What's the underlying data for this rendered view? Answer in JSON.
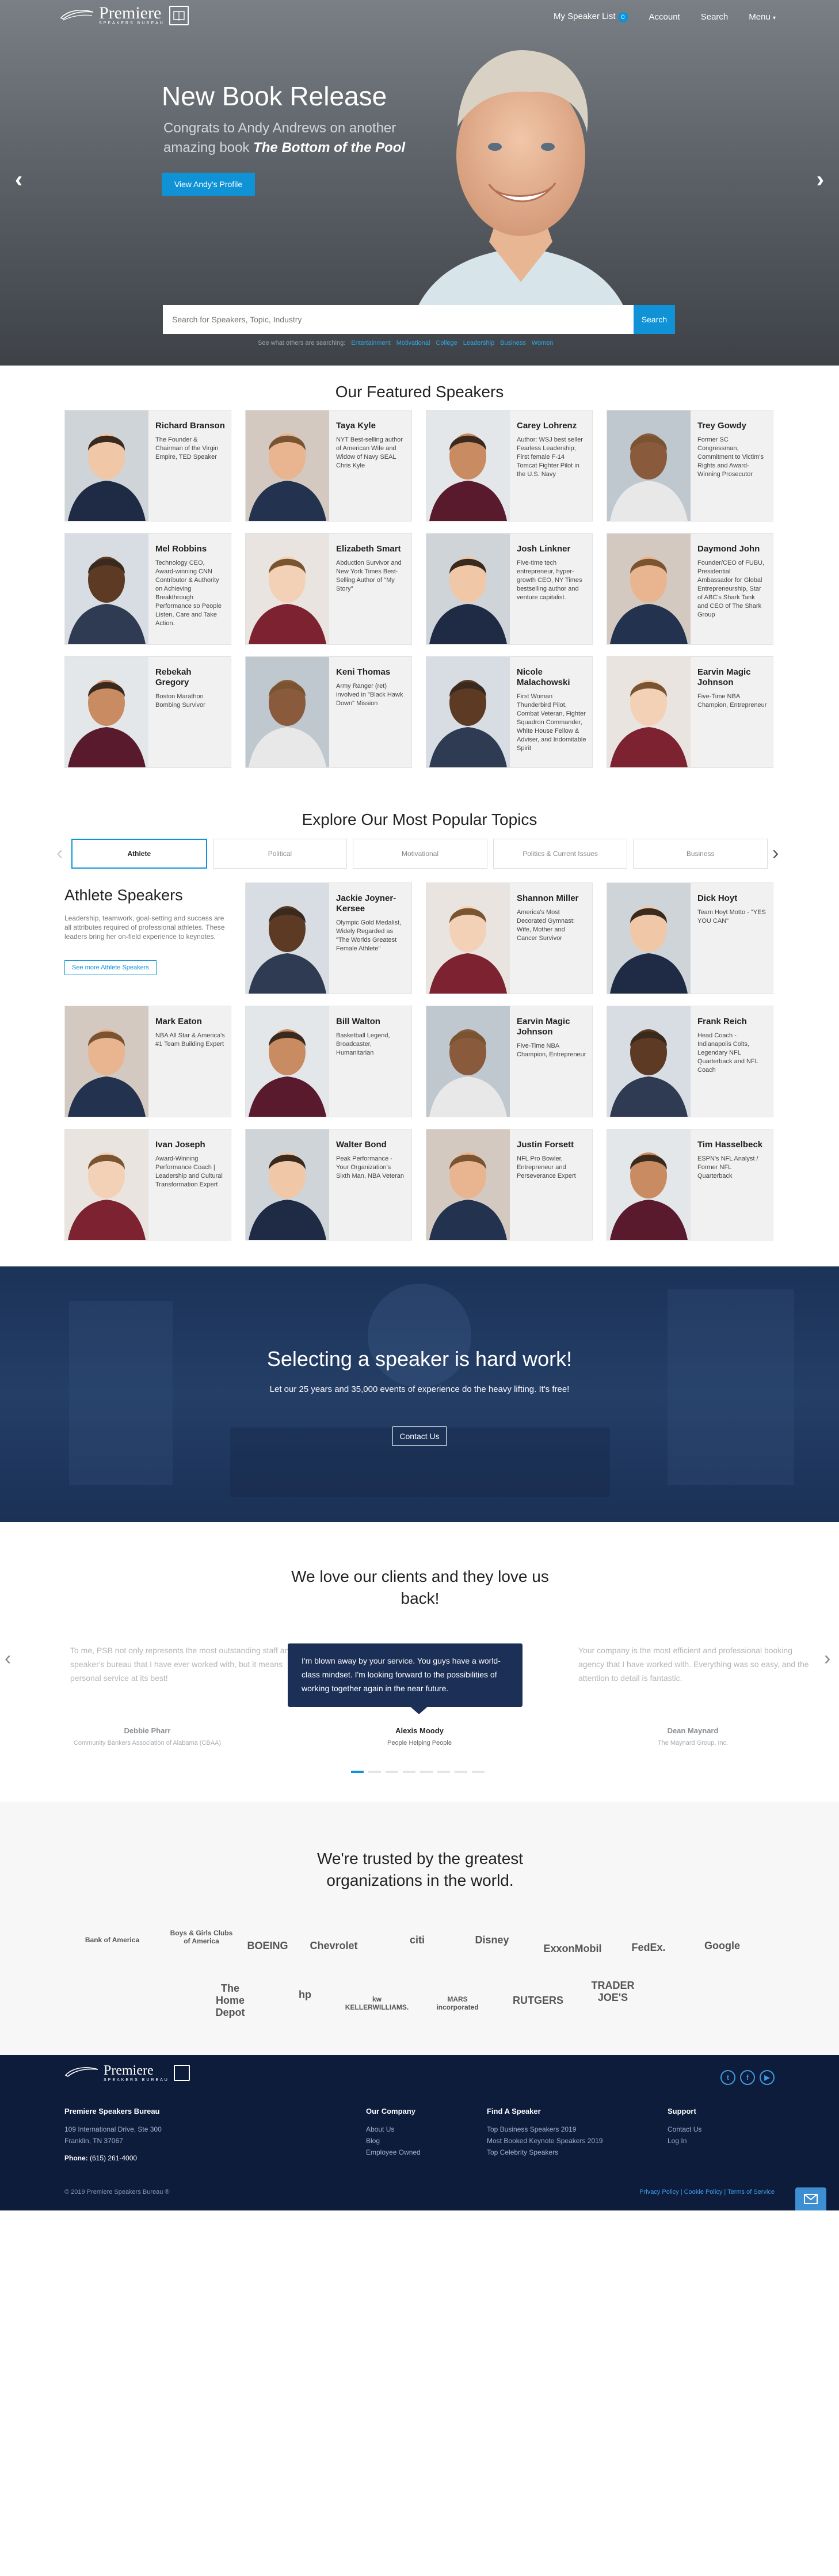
{
  "header": {
    "logo_word": "Premiere",
    "logo_sub": "SPEAKERS BUREAU",
    "nav": {
      "speaker_list": "My Speaker List",
      "speaker_list_count": "0",
      "account": "Account",
      "search": "Search",
      "menu": "Menu"
    }
  },
  "hero": {
    "title": "New Book Release",
    "subtitle": "Congrats to Andy Andrews on another amazing book",
    "book": "The Bottom of the Pool",
    "button": "View Andy's Profile",
    "search_placeholder": "Search for Speakers, Topic, Industry",
    "search_button": "Search",
    "popular_label": "See what others are searching:",
    "popular_tags": [
      "Entertainment",
      "Motivational",
      "College",
      "Leadership",
      "Business",
      "Women"
    ]
  },
  "featured": {
    "title": "Our Featured Speakers",
    "speakers": [
      {
        "name": "Richard Branson",
        "desc": "The Founder & Chairman of the Virgin Empire, TED Speaker"
      },
      {
        "name": "Taya Kyle",
        "desc": "NYT Best-selling author of American Wife and Widow of Navy SEAL Chris Kyle"
      },
      {
        "name": "Carey Lohrenz",
        "desc": "Author: WSJ best seller Fearless Leadership; First female F-14 Tomcat Fighter Pilot in the U.S. Navy"
      },
      {
        "name": "Trey Gowdy",
        "desc": "Former SC Congressman, Commitment to Victim's Rights and Award-Winning Prosecutor"
      },
      {
        "name": "Mel Robbins",
        "desc": "Technology CEO, Award-winning CNN Contributor & Authority on Achieving Breakthrough Performance so People Listen, Care and Take Action."
      },
      {
        "name": "Elizabeth Smart",
        "desc": "Abduction Survivor and New York Times Best-Selling Author of \"My Story\""
      },
      {
        "name": "Josh Linkner",
        "desc": "Five-time tech entrepreneur, hyper-growth CEO, NY Times bestselling author and venture capitalist."
      },
      {
        "name": "Daymond John",
        "desc": "Founder/CEO of FUBU, Presidential Ambassador for Global Entrepreneurship, Star of ABC's Shark Tank and CEO of The Shark Group"
      },
      {
        "name": "Rebekah Gregory",
        "desc": "Boston Marathon Bombing Survivor"
      },
      {
        "name": "Keni Thomas",
        "desc": "Army Ranger (ret) involved in \"Black Hawk Down\" Mission"
      },
      {
        "name": "Nicole Malachowski",
        "desc": "First Woman Thunderbird Pilot, Combat Veteran, Fighter Squadron Commander, White House Fellow & Adviser, and Indomitable Spirit"
      },
      {
        "name": "Earvin Magic Johnson",
        "desc": "Five-Time NBA Champion, Entrepreneur"
      }
    ]
  },
  "topics": {
    "title": "Explore Our Most Popular Topics",
    "tabs": [
      "Athlete",
      "Political",
      "Motivational",
      "Politics & Current Issues",
      "Business"
    ],
    "category_title": "Athlete Speakers",
    "category_desc": "Leadership, teamwork, goal-setting and success are all attributes required of professional athletes. These leaders bring her on-field experience to keynotes.",
    "category_button": "See more Athlete Speakers",
    "speakers": [
      {
        "name": "Jackie Joyner-Kersee",
        "desc": "Olympic Gold Medalist, Widely Regarded as \"The Worlds Greatest Female Athlete\""
      },
      {
        "name": "Shannon Miller",
        "desc": "America's Most Decorated Gymnast: Wife, Mother and Cancer Survivor"
      },
      {
        "name": "Dick Hoyt",
        "desc": "Team Hoyt Motto - \"YES YOU CAN\""
      },
      {
        "name": "Mark Eaton",
        "desc": "NBA All Star & America's #1 Team Building Expert"
      },
      {
        "name": "Bill Walton",
        "desc": "Basketball Legend, Broadcaster, Humanitarian"
      },
      {
        "name": "Earvin Magic Johnson",
        "desc": "Five-Time NBA Champion, Entrepreneur"
      },
      {
        "name": "Frank Reich",
        "desc": "Head Coach - Indianapolis Colts, Legendary NFL Quarterback and NFL Coach"
      },
      {
        "name": "Ivan Joseph",
        "desc": "Award-Winning Performance Coach | Leadership and Cultural Transformation Expert"
      },
      {
        "name": "Walter Bond",
        "desc": "Peak Performance - Your Organization's Sixth Man, NBA Veteran"
      },
      {
        "name": "Justin Forsett",
        "desc": "NFL Pro Bowler, Entrepreneur and Perseverance Expert"
      },
      {
        "name": "Tim Hasselbeck",
        "desc": "ESPN's NFL Analyst / Former NFL Quarterback"
      }
    ]
  },
  "cta": {
    "title": "Selecting a speaker is hard work!",
    "text": "Let our 25 years and 35,000 events of experience do the heavy lifting. It's free!",
    "button": "Contact Us"
  },
  "testimonials": {
    "title": "We love our clients and they love us back!",
    "items": [
      {
        "quote": "To me, PSB not only represents the most outstanding staff and speaker's bureau that I have ever worked with, but it means personal service at its best!",
        "name": "Debbie Pharr",
        "org": "Community Bankers Association of Alabama (CBAA)"
      },
      {
        "quote": "I'm blown away by your service. You guys have a world-class mindset. I'm looking forward to the possibilities of working together again in the near future.",
        "name": "Alexis Moody",
        "org": "People Helping People"
      },
      {
        "quote": "Your company is the most efficient and professional booking agency that I have worked with. Everything was so easy, and the attention to detail is fantastic.",
        "name": "Dean Maynard",
        "org": "The Maynard Group, Inc."
      }
    ]
  },
  "trusted": {
    "title": "We're trusted by the greatest organizations in the world.",
    "logos": [
      "Bank of America",
      "Boys & Girls Clubs of America",
      "BOEING",
      "Chevrolet",
      "citi",
      "Disney",
      "ExxonMobil",
      "FedEx.",
      "Google",
      "The Home Depot",
      "hp",
      "kw KELLERWILLIAMS.",
      "MARS incorporated",
      "RUTGERS",
      "TRADER JOE'S"
    ]
  },
  "footer": {
    "company": "Premiere Speakers Bureau",
    "address1": "109 International Drive, Ste 300",
    "address2": "Franklin, TN 37067",
    "phone_label": "Phone:",
    "phone": "(615) 261-4000",
    "our_company": {
      "title": "Our Company",
      "links": [
        "About Us",
        "Blog",
        "Employee Owned"
      ]
    },
    "find_speaker": {
      "title": "Find A Speaker",
      "links": [
        "Top Business Speakers 2019",
        "Most Booked Keynote Speakers 2019",
        "Top Celebrity Speakers"
      ]
    },
    "support": {
      "title": "Support",
      "links": [
        "Contact Us",
        "Log In"
      ]
    },
    "copyright": "© 2019 Premiere Speakers Bureau ®",
    "legal": "Privacy Policy | Cookie Policy | Terms of Service"
  },
  "colors": {
    "accent": "#0f93d6",
    "navy": "#1b2f57",
    "footer": "#0e1c3c"
  }
}
